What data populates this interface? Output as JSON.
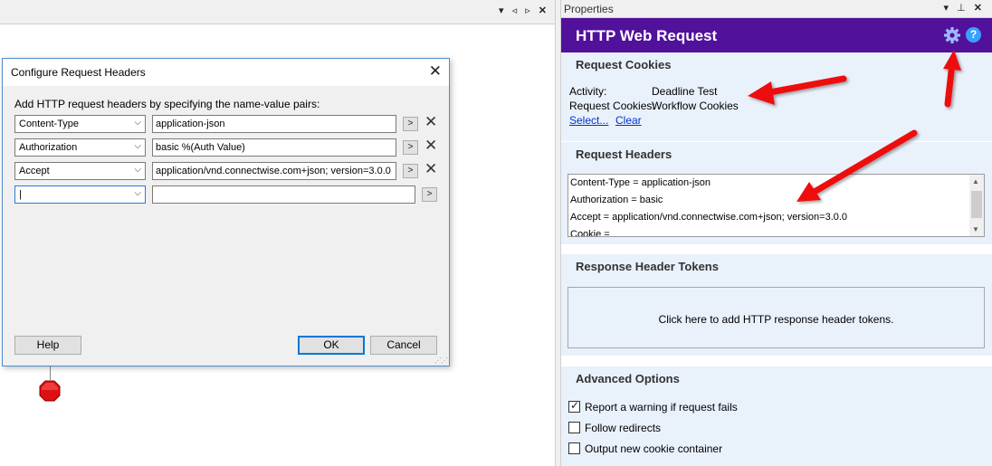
{
  "designer": {
    "tab_controls": [
      "▾",
      "◃",
      "▹",
      "✕"
    ]
  },
  "dialog": {
    "title": "Configure Request Headers",
    "close_glyph": "✕",
    "intro": "Add HTTP request headers by specifying the name-value pairs:",
    "rows": [
      {
        "name": "Content-Type",
        "value": "application-json"
      },
      {
        "name": "Authorization",
        "value": "basic %(Auth Value)"
      },
      {
        "name": "Accept",
        "value": "application/vnd.connectwise.com+json; version=3.0.0"
      },
      {
        "name": "|",
        "value": ""
      }
    ],
    "dropdown_glyph": "⌵",
    "insert_glyph": ">",
    "delete_glyph": "✕",
    "help_label": "Help",
    "ok_label": "OK",
    "cancel_label": "Cancel"
  },
  "properties": {
    "panel_title": "Properties",
    "panel_controls": [
      "▾",
      "⊥",
      "✕"
    ],
    "header_title": "HTTP Web Request",
    "header_color": "#52119b",
    "help_glyph": "?",
    "cookies": {
      "title": "Request Cookies",
      "activity_label": "Activity:",
      "activity_value": "Deadline Test",
      "cookies_label": "Request Cookies:",
      "cookies_value": "Workflow Cookies",
      "select_link": "Select...",
      "clear_link": "Clear"
    },
    "headers": {
      "title": "Request Headers",
      "lines": [
        "Content-Type = application-json",
        "Authorization = basic",
        "Accept = application/vnd.connectwise.com+json; version=3.0.0",
        "Cookie ="
      ]
    },
    "tokens": {
      "title": "Response Header Tokens",
      "hint": "Click here to add HTTP response header tokens."
    },
    "advanced": {
      "title": "Advanced Options",
      "options": [
        {
          "label": "Report a warning if request fails",
          "checked": true
        },
        {
          "label": "Follow redirects",
          "checked": false
        },
        {
          "label": "Output new cookie container",
          "checked": false
        }
      ]
    }
  },
  "colors": {
    "accent_arrow": "#ee1111",
    "stop_shape": "#dd1111"
  }
}
